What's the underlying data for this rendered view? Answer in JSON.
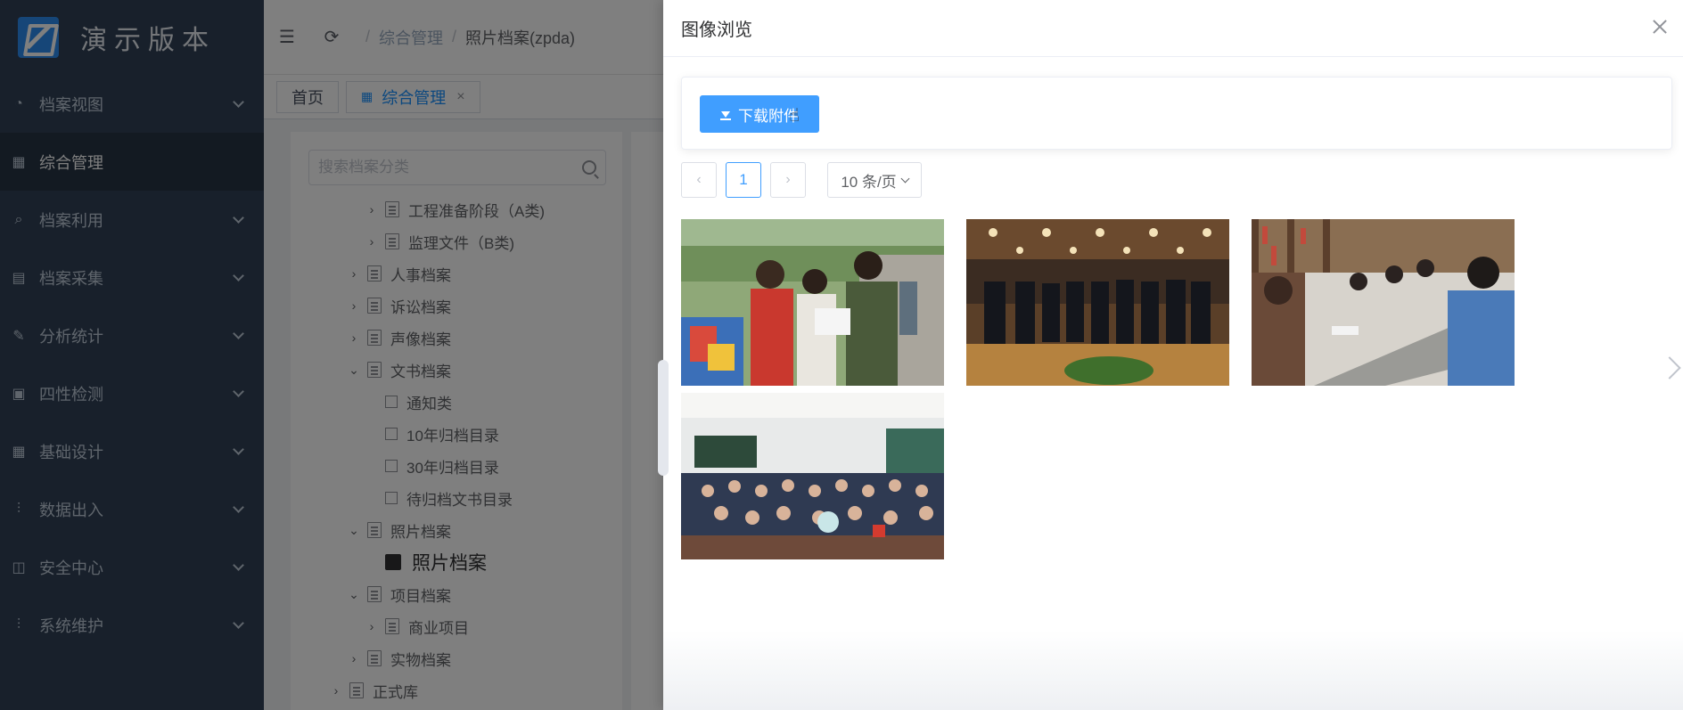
{
  "app": {
    "title": "演示版本",
    "accent": "#409eff",
    "sidebar_bg": "#304156"
  },
  "sidebar": {
    "items": [
      {
        "label": "档案视图",
        "icon": "dashboard-icon",
        "arrow": true,
        "active": false
      },
      {
        "label": "综合管理",
        "icon": "grid-icon",
        "arrow": false,
        "active": true
      },
      {
        "label": "档案利用",
        "icon": "search-icon",
        "arrow": true,
        "active": false
      },
      {
        "label": "档案采集",
        "icon": "collect-icon",
        "arrow": true,
        "active": false
      },
      {
        "label": "分析统计",
        "icon": "edit-icon",
        "arrow": true,
        "active": false
      },
      {
        "label": "四性检测",
        "icon": "check-icon",
        "arrow": true,
        "active": false
      },
      {
        "label": "基础设计",
        "icon": "table-icon",
        "arrow": true,
        "active": false
      },
      {
        "label": "数据出入",
        "icon": "sliders-icon",
        "arrow": true,
        "active": false
      },
      {
        "label": "安全中心",
        "icon": "briefcase-icon",
        "arrow": true,
        "active": false
      },
      {
        "label": "系统维护",
        "icon": "sliders-icon",
        "arrow": true,
        "active": false
      }
    ]
  },
  "breadcrumb": {
    "items": [
      "综合管理",
      "照片档案(zpda)"
    ],
    "sep": "/"
  },
  "tags": {
    "home": "首页",
    "current": "综合管理",
    "close": "×"
  },
  "tree": {
    "search_placeholder": "搜索档案分类",
    "nodes": [
      {
        "label": "工程准备阶段（A类)",
        "kind": "doc",
        "chev": "›",
        "level": 2
      },
      {
        "label": "监理文件（B类)",
        "kind": "doc",
        "chev": "›",
        "level": 2
      },
      {
        "label": "人事档案",
        "kind": "doc",
        "chev": "›",
        "level": 1
      },
      {
        "label": "诉讼档案",
        "kind": "doc",
        "chev": "›",
        "level": 1
      },
      {
        "label": "声像档案",
        "kind": "doc",
        "chev": "›",
        "level": 1
      },
      {
        "label": "文书档案",
        "kind": "doc",
        "chev": "⌄",
        "level": 1
      },
      {
        "label": "通知类",
        "kind": "link",
        "chev": "",
        "level": 2
      },
      {
        "label": "10年归档目录",
        "kind": "link",
        "chev": "",
        "level": 2
      },
      {
        "label": "30年归档目录",
        "kind": "link",
        "chev": "",
        "level": 2
      },
      {
        "label": "待归档文书目录",
        "kind": "link",
        "chev": "",
        "level": 2
      },
      {
        "label": "照片档案",
        "kind": "doc",
        "chev": "⌄",
        "level": 1
      },
      {
        "label": "照片档案",
        "kind": "selected",
        "chev": "",
        "level": 2
      },
      {
        "label": "项目档案",
        "kind": "doc",
        "chev": "⌄",
        "level": 1
      },
      {
        "label": "商业项目",
        "kind": "doc",
        "chev": "›",
        "level": 2
      },
      {
        "label": "实物档案",
        "kind": "doc",
        "chev": "›",
        "level": 1
      },
      {
        "label": "正式库",
        "kind": "doc",
        "chev": "›",
        "level": 0
      }
    ]
  },
  "drawer": {
    "title": "图像浏览",
    "download_label": "下载附件",
    "pager": {
      "prev": "‹",
      "next": "›",
      "current_page": "1",
      "page_size": "10 条/页"
    },
    "images": [
      {
        "name": "students-outdoor-photo"
      },
      {
        "name": "ceremony-hall-photo"
      },
      {
        "name": "library-meeting-photo"
      },
      {
        "name": "classroom-audience-photo"
      }
    ]
  }
}
